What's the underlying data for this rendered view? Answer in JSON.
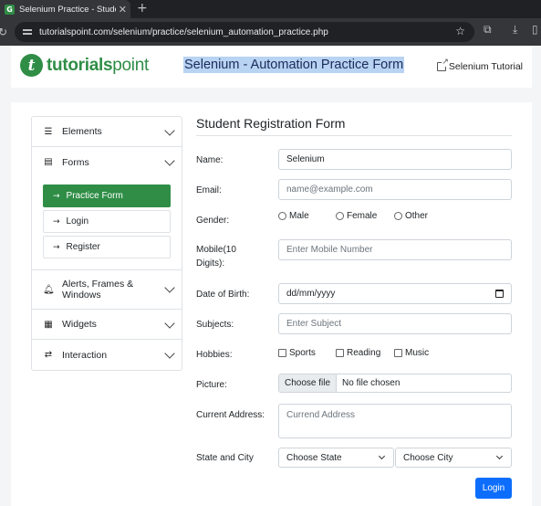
{
  "browser": {
    "tab_title": "Selenium Practice - Student",
    "favicon_letter": "G",
    "url": "tutorialspoint.com/selenium/practice/selenium_automation_practice.php"
  },
  "header": {
    "logo_mark": "t",
    "logo_bold": "tutorials",
    "logo_light": "point",
    "title": "Selenium - Automation Practice Form",
    "tutorial_link": "Selenium Tutorial",
    "brand_color": "#2f8d46"
  },
  "sidebar": {
    "items": [
      {
        "label": "Elements",
        "icon": "hamburger-icon"
      },
      {
        "label": "Forms",
        "icon": "form-list-icon"
      },
      {
        "label": "Alerts, Frames & Windows",
        "icon": "bell-icon"
      },
      {
        "label": "Widgets",
        "icon": "grid-icon"
      },
      {
        "label": "Interaction",
        "icon": "swap-arrows-icon"
      }
    ],
    "forms_sub": [
      {
        "label": "Practice Form",
        "active": true
      },
      {
        "label": "Login",
        "active": false
      },
      {
        "label": "Register",
        "active": false
      }
    ]
  },
  "form": {
    "title": "Student Registration Form",
    "name_label": "Name:",
    "name_value": "Selenium",
    "email_label": "Email:",
    "email_placeholder": "name@example.com",
    "gender_label": "Gender:",
    "gender_options": [
      "Male",
      "Female",
      "Other"
    ],
    "mobile_label_1": "Mobile(10",
    "mobile_label_2": "Digits):",
    "mobile_placeholder": "Enter Mobile Number",
    "dob_label": "Date of Birth:",
    "dob_value": "dd/mm/yyyy",
    "subjects_label": "Subjects:",
    "subjects_placeholder": "Enter Subject",
    "hobbies_label": "Hobbies:",
    "hobbies_options": [
      "Sports",
      "Reading",
      "Music"
    ],
    "picture_label": "Picture:",
    "file_button": "Choose file",
    "file_status": "No file chosen",
    "address_label": "Current Address:",
    "address_placeholder": "Currend Address",
    "state_city_label": "State and City",
    "state_select": "Choose State",
    "city_select": "Choose City",
    "submit_label": "Login",
    "submit_color": "#0d6efd"
  }
}
